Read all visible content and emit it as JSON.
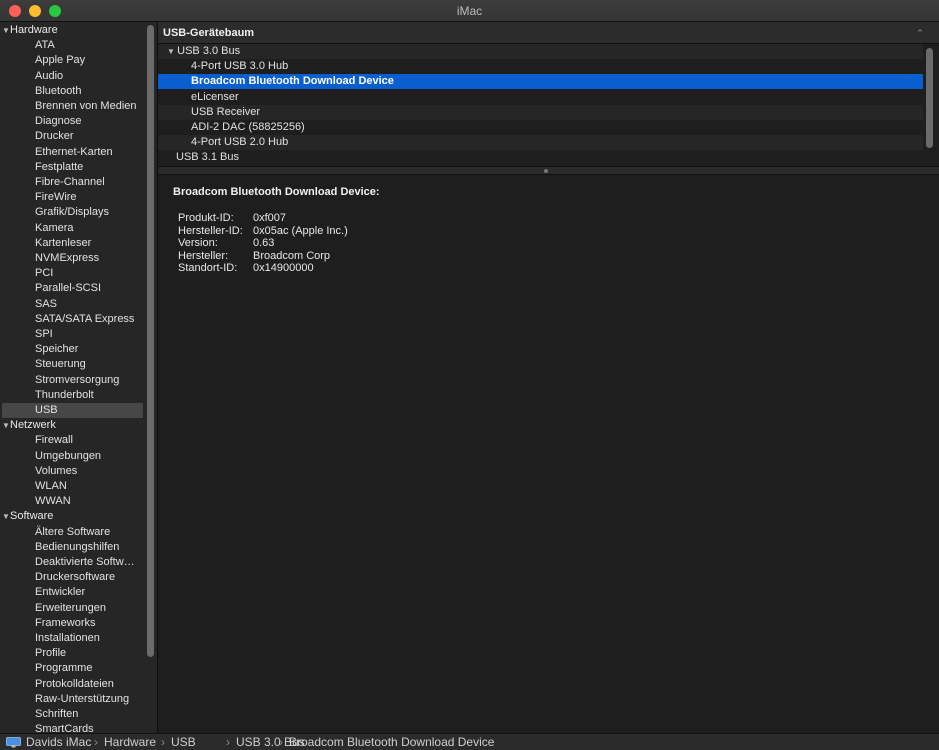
{
  "window": {
    "title": "iMac"
  },
  "sidebar": {
    "groups": [
      {
        "label": "Hardware",
        "items": [
          "ATA",
          "Apple Pay",
          "Audio",
          "Bluetooth",
          "Brennen von Medien",
          "Diagnose",
          "Drucker",
          "Ethernet-Karten",
          "Festplatte",
          "Fibre-Channel",
          "FireWire",
          "Grafik/Displays",
          "Kamera",
          "Kartenleser",
          "NVMExpress",
          "PCI",
          "Parallel-SCSI",
          "SAS",
          "SATA/SATA Express",
          "SPI",
          "Speicher",
          "Steuerung",
          "Stromversorgung",
          "Thunderbolt",
          "USB"
        ]
      },
      {
        "label": "Netzwerk",
        "items": [
          "Firewall",
          "Umgebungen",
          "Volumes",
          "WLAN",
          "WWAN"
        ]
      },
      {
        "label": "Software",
        "items": [
          "Ältere Software",
          "Bedienungshilfen",
          "Deaktivierte Softw…",
          "Druckersoftware",
          "Entwickler",
          "Erweiterungen",
          "Frameworks",
          "Installationen",
          "Profile",
          "Programme",
          "Protokolldateien",
          "Raw-Unterstützung",
          "Schriften",
          "SmartCards"
        ]
      }
    ],
    "selected": "USB"
  },
  "tree": {
    "header": "USB-Gerätebaum",
    "rows": [
      {
        "label": "USB 3.0 Bus",
        "level": 0,
        "expanded": true
      },
      {
        "label": "4-Port USB 3.0 Hub",
        "level": 1
      },
      {
        "label": "Broadcom Bluetooth Download Device",
        "level": 1,
        "selected": true
      },
      {
        "label": "eLicenser",
        "level": 1
      },
      {
        "label": "USB Receiver",
        "level": 1
      },
      {
        "label": "ADI-2 DAC (58825256)",
        "level": 1
      },
      {
        "label": "4-Port USB 2.0 Hub",
        "level": 1
      },
      {
        "label": "USB 3.1 Bus",
        "level": 0
      }
    ]
  },
  "detail": {
    "title": "Broadcom Bluetooth Download Device:",
    "properties": [
      {
        "key": "Produkt-ID:",
        "value": "0xf007"
      },
      {
        "key": "Hersteller-ID:",
        "value": "0x05ac (Apple Inc.)"
      },
      {
        "key": "Version:",
        "value": "0.63"
      },
      {
        "key": "Hersteller:",
        "value": "Broadcom Corp"
      },
      {
        "key": "Standort-ID:",
        "value": "0x14900000"
      }
    ]
  },
  "breadcrumb": [
    "Davids iMac",
    "Hardware",
    "USB",
    "USB 3.0 Bus",
    "Broadcom Bluetooth Download Device"
  ],
  "colors": {
    "selection": "#0a5fd0",
    "close": "#fe5f57",
    "minimize": "#febc2e",
    "maximize": "#28c840"
  }
}
